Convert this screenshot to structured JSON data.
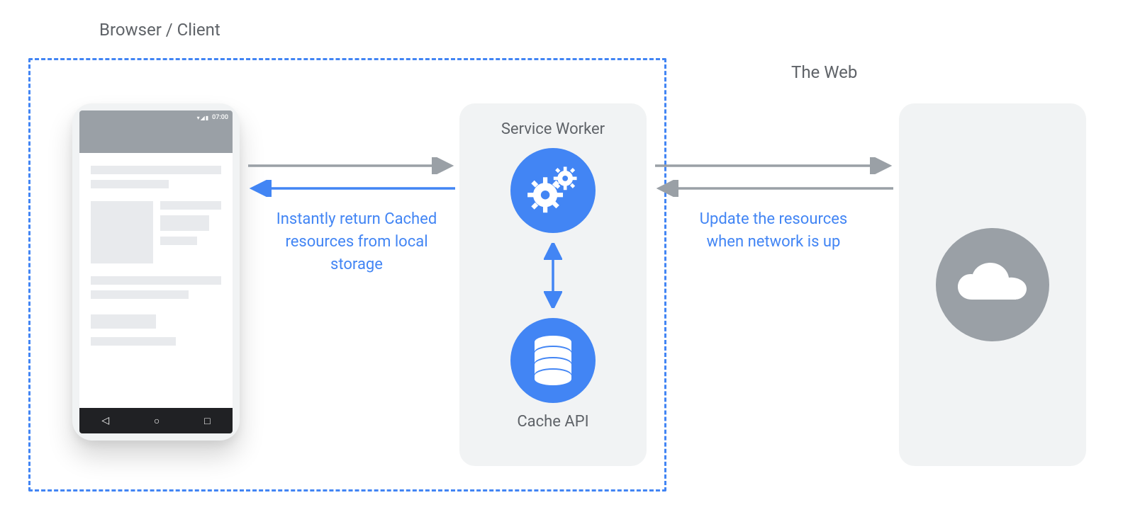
{
  "diagram": {
    "browserTitle": "Browser / Client",
    "webTitle": "The Web",
    "serviceWorkerLabel": "Service Worker",
    "cacheApiLabel": "Cache API",
    "captionLeft": "Instantly return Cached resources from local storage",
    "captionRight": "Update the resources when network is up",
    "phone": {
      "statusTime": "07:00"
    },
    "icons": {
      "serviceWorker": "gears-icon",
      "cacheApi": "database-icon",
      "web": "cloud-icon"
    },
    "colors": {
      "blue": "#4285f4",
      "gray": "#9aa0a6",
      "textGray": "#5f6368",
      "panelGray": "#f1f3f4"
    }
  }
}
